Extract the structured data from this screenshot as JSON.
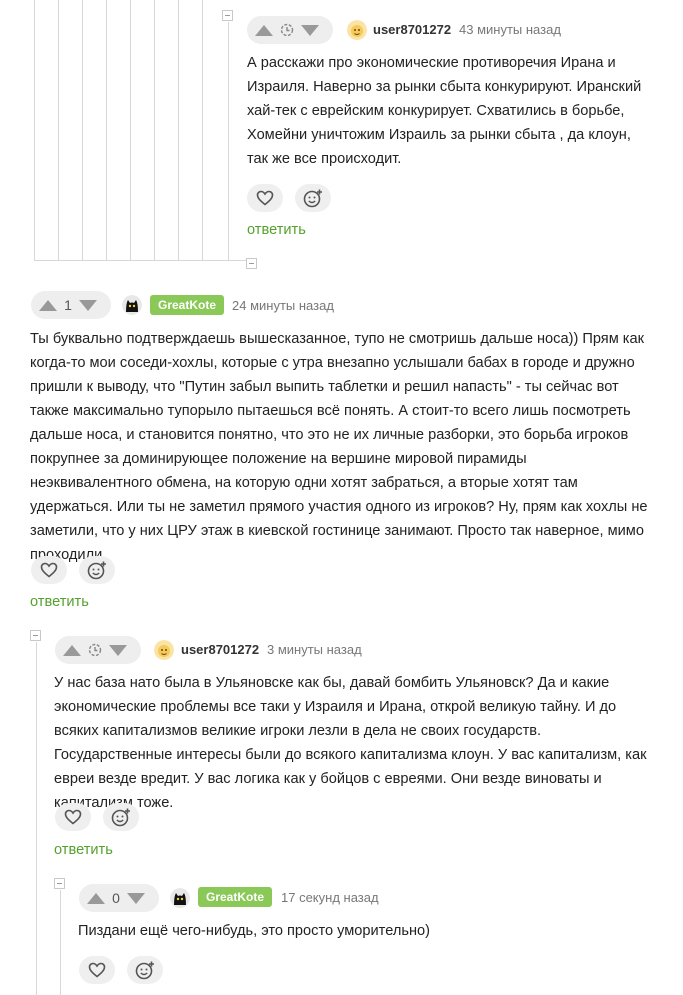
{
  "colors": {
    "accent_green": "#54a12d",
    "badge_green": "#8ac858",
    "vote_bg": "#eeeeee",
    "thread_line": "#d7d7d7"
  },
  "icons": {
    "vote_up": "triangle-up-icon",
    "vote_down": "triangle-down-icon",
    "rating_hidden": "clock-icon",
    "like": "heart-icon",
    "reaction": "smiley-plus-icon",
    "collapse": "collapse-minus-icon"
  },
  "comments": [
    {
      "author": "user8701272",
      "time": "43 минуты назад",
      "rating": "",
      "text": "А расскажи про экономические противоречия Ирана и Израиля. Наверно за рынки сбыта конкурируют. Иранский хай-тек с еврейским конкурирует. Схватились в борьбе, Хомейни уничтожим Израиль за рынки сбыта , да клоун, так же все происходит.",
      "reply_label": "ответить"
    },
    {
      "author": "GreatKote",
      "time": "24 минуты назад",
      "rating": "1",
      "text": "Ты буквально подтверждаешь вышесказанное, тупо не смотришь дальше носа)) Прям как когда-то мои соседи-хохлы, которые с утра внезапно услышали бабах в городе и дружно пришли к выводу, что \"Путин забыл выпить таблетки и решил напасть\" - ты сейчас вот также максимально тупорыло пытаешься всё понять. А стоит-то всего лишь посмотреть дальше носа, и становится понятно, что это не их личные разборки, это борьба игроков покрупнее за доминирующее положение на вершине мировой пирамиды неэквивалентного обмена, на которую одни хотят забраться, а вторые хотят там удержаться. Или ты не заметил прямого участия одного из игроков? Ну, прям как хохлы не заметили, что у них ЦРУ этаж в киевской гостинице занимают. Просто так наверное, мимо проходили",
      "reply_label": "ответить"
    },
    {
      "author": "user8701272",
      "time": "3 минуты назад",
      "rating": "",
      "text": "У нас база нато была в Ульяновске как бы, давай бомбить Ульяновск? Да и какие экономические проблемы все таки у Израиля и Ирана, открой великую тайну. И до всяких капитализмов великие игроки лезли в дела не своих государств. Государственные интересы были до всякого капитализма клоун. У вас капитализм, как евреи везде вредит. У вас логика как у бойцов с евреями. Они везде виноваты и капитализм тоже.",
      "reply_label": "ответить"
    },
    {
      "author": "GreatKote",
      "time": "17 секунд назад",
      "rating": "0",
      "text": "Пиздани ещё чего-нибудь, это просто уморительно)",
      "reply_label": ""
    }
  ]
}
